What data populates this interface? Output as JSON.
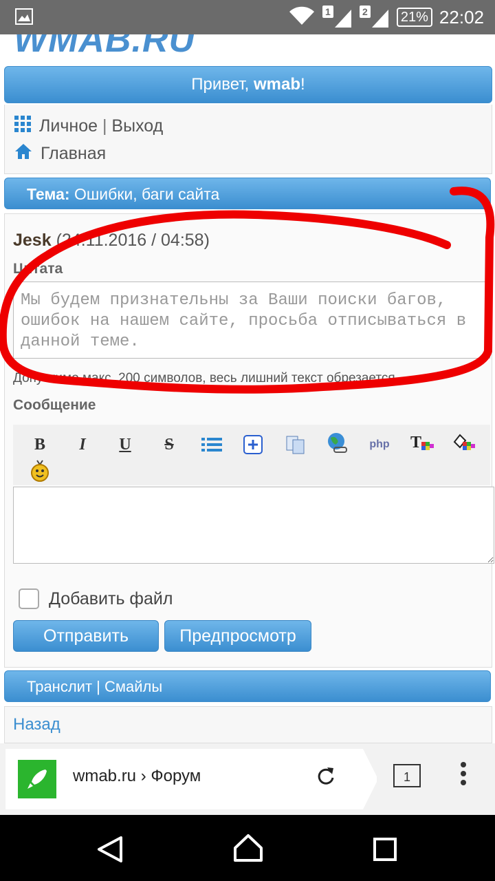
{
  "status_bar": {
    "time": "22:02",
    "battery": "21%",
    "sim1": "1",
    "sim2": "2"
  },
  "site": {
    "logo": "WMAB.RU",
    "greeting_prefix": "Привет, ",
    "username": "wmab",
    "greeting_suffix": "!"
  },
  "nav": {
    "personal": "Личное",
    "separator": "|",
    "logout": "Выход",
    "home": "Главная"
  },
  "topic": {
    "label": "Тема:",
    "title": "Ошибки, баги сайта"
  },
  "post": {
    "author": "Jesk",
    "date": "(24.11.2016 / 04:58)",
    "quote_label": "Цитата",
    "quote_text": "Мы будем признательны за Ваши поиски багов, ошибок на нашем сайте, просьба отписываться в данной теме.",
    "hint": "Допустимо макс. 200 символов, весь лишний текст обрезается."
  },
  "editor": {
    "message_label": "Сообщение",
    "message_value": "",
    "attach_label": "Добавить файл",
    "send_button": "Отправить",
    "preview_button": "Предпросмотр"
  },
  "footer": {
    "translit": "Транслит",
    "separator": "|",
    "smileys": "Смайлы",
    "back": "Назад"
  },
  "browser": {
    "url": "wmab.ru › Форум",
    "tab_count": "1"
  },
  "colors": {
    "accent": "#3b8ed0",
    "annotation": "#ee0000",
    "favicon": "#2bb52e"
  }
}
